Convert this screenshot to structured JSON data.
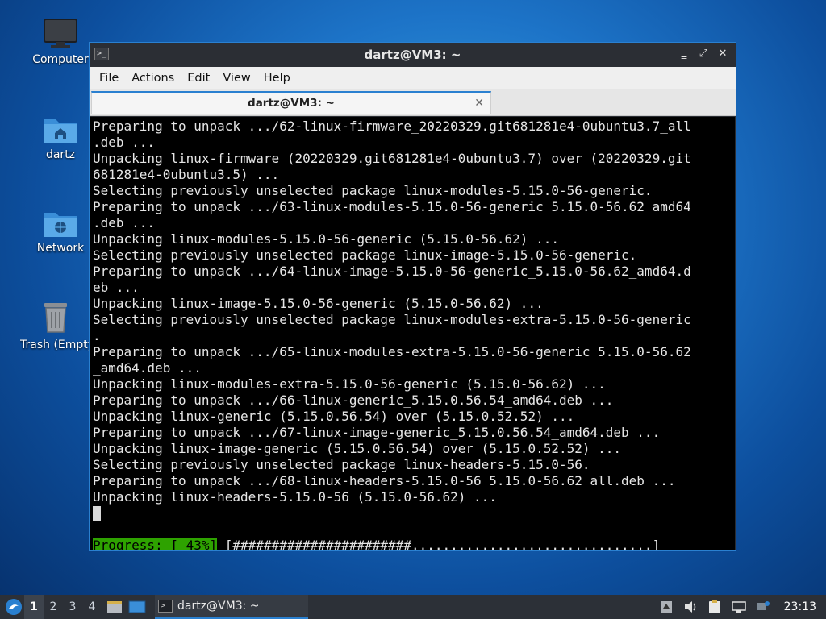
{
  "desktop": {
    "icons": [
      {
        "label": "Computer"
      },
      {
        "label": "dartz"
      },
      {
        "label": "Network"
      },
      {
        "label": "Trash (Empty)"
      }
    ]
  },
  "window": {
    "title": "dartz@VM3: ~",
    "controls": {
      "minimize": "‗",
      "maximize": "⤢",
      "close": "✕"
    },
    "menu": [
      "File",
      "Actions",
      "Edit",
      "View",
      "Help"
    ],
    "tab": {
      "label": "dartz@VM3: ~",
      "close": "✕"
    }
  },
  "terminal": {
    "lines": [
      "Preparing to unpack .../62-linux-firmware_20220329.git681281e4-0ubuntu3.7_all",
      ".deb ...",
      "Unpacking linux-firmware (20220329.git681281e4-0ubuntu3.7) over (20220329.git",
      "681281e4-0ubuntu3.5) ...",
      "Selecting previously unselected package linux-modules-5.15.0-56-generic.",
      "Preparing to unpack .../63-linux-modules-5.15.0-56-generic_5.15.0-56.62_amd64",
      ".deb ...",
      "Unpacking linux-modules-5.15.0-56-generic (5.15.0-56.62) ...",
      "Selecting previously unselected package linux-image-5.15.0-56-generic.",
      "Preparing to unpack .../64-linux-image-5.15.0-56-generic_5.15.0-56.62_amd64.d",
      "eb ...",
      "Unpacking linux-image-5.15.0-56-generic (5.15.0-56.62) ...",
      "Selecting previously unselected package linux-modules-extra-5.15.0-56-generic",
      ".",
      "Preparing to unpack .../65-linux-modules-extra-5.15.0-56-generic_5.15.0-56.62",
      "_amd64.deb ...",
      "Unpacking linux-modules-extra-5.15.0-56-generic (5.15.0-56.62) ...",
      "Preparing to unpack .../66-linux-generic_5.15.0.56.54_amd64.deb ...",
      "Unpacking linux-generic (5.15.0.56.54) over (5.15.0.52.52) ...",
      "Preparing to unpack .../67-linux-image-generic_5.15.0.56.54_amd64.deb ...",
      "Unpacking linux-image-generic (5.15.0.56.54) over (5.15.0.52.52) ...",
      "Selecting previously unselected package linux-headers-5.15.0-56.",
      "Preparing to unpack .../68-linux-headers-5.15.0-56_5.15.0-56.62_all.deb ...",
      "Unpacking linux-headers-5.15.0-56 (5.15.0-56.62) ..."
    ],
    "progress": {
      "label": "Progress: [ 43%]",
      "percent": 43,
      "bar": " [#######################...............................]"
    }
  },
  "taskbar": {
    "workspaces": [
      "1",
      "2",
      "3",
      "4"
    ],
    "active_workspace": "1",
    "task_label": "dartz@VM3: ~",
    "clock": "23:13"
  },
  "colors": {
    "accent": "#2a80d0",
    "progress": "#2ea200"
  }
}
